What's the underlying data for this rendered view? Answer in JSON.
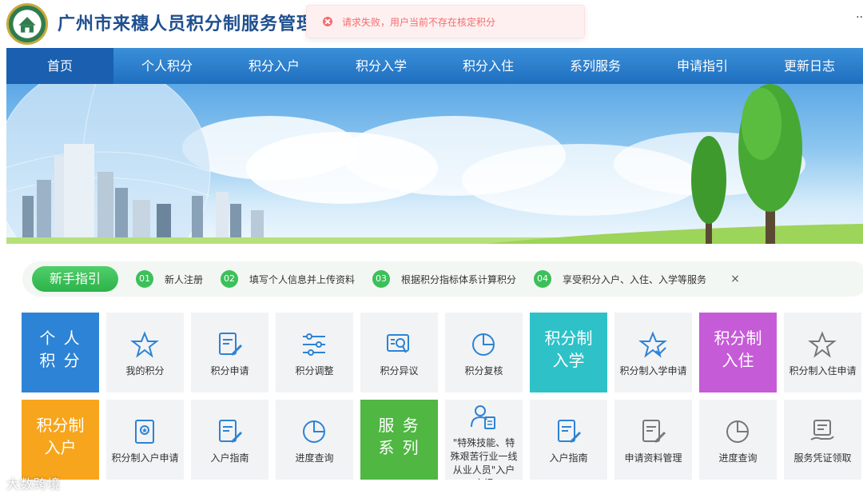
{
  "header": {
    "title": "广州市来穗人员积分制服务管理",
    "right_text": "··"
  },
  "toast": {
    "message": "请求失败，用户当前不存在核定积分"
  },
  "nav": {
    "items": [
      "首页",
      "个人积分",
      "积分入户",
      "积分入学",
      "积分入住",
      "系列服务",
      "申请指引",
      "更新日志"
    ]
  },
  "guide": {
    "label": "新手指引",
    "steps": [
      {
        "num": "01",
        "text": "新人注册"
      },
      {
        "num": "02",
        "text": "填写个人信息并上传资料"
      },
      {
        "num": "03",
        "text": "根据积分指标体系计算积分"
      },
      {
        "num": "04",
        "text": "享受积分入户、入住、入学等服务"
      }
    ],
    "close": "×"
  },
  "tiles_row1": {
    "personal": "个 人\n积 分",
    "my_points": "我的积分",
    "apply": "积分申请",
    "adjust": "积分调整",
    "objection": "积分异议",
    "review": "积分复核",
    "school": "积分制\n入学",
    "school_apply": "积分制入学申请",
    "housing": "积分制\n入住",
    "housing_apply": "积分制入住申请"
  },
  "tiles_row2": {
    "household": "积分制\n入户",
    "household_apply": "积分制入户申请",
    "household_guide": "入户指南",
    "progress": "进度查询",
    "services": "服 务\n系 列",
    "special": "\"特殊技能、特殊艰苦行业一线从业人员\"入户申报",
    "guide2": "入户指南",
    "docs": "申请资料管理",
    "progress2": "进度查询",
    "voucher": "服务凭证领取"
  },
  "watermark": "大数跨境",
  "colors": {
    "nav": "#1f6fc0",
    "guide_green": "#3cc05a",
    "tile_blue": "#2d83d5",
    "tile_teal": "#2ec2c8",
    "tile_purple": "#c65bd8",
    "tile_orange": "#f7a51c",
    "tile_green": "#4fb742",
    "error": "#f56c6c"
  }
}
